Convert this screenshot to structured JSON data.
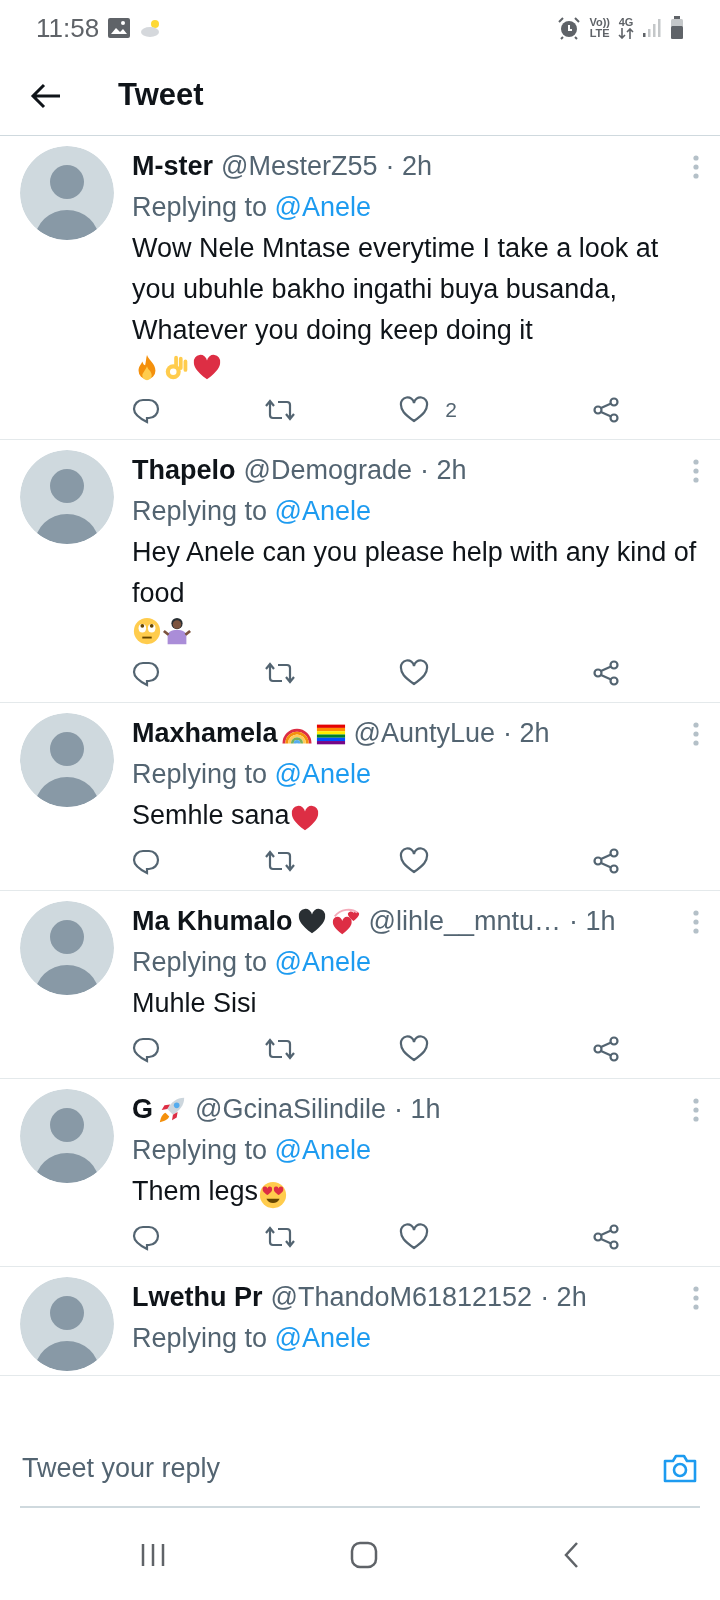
{
  "status_bar": {
    "time": "11:58",
    "volte": "Vo))",
    "lte": "LTE",
    "network": "4G"
  },
  "header": {
    "title": "Tweet"
  },
  "tweets": [
    {
      "name": "M-ster",
      "handle": "@MesterZ55",
      "time": "· 2h",
      "replying_label": "Replying to",
      "replying_handle": "@Anele",
      "text": "Wow Nele Mntase everytime I take a look at you ubuhle bakho ingathi buya busanda, Whatever you doing keep doing it",
      "text_emojis": [
        {
          "kind": "fire"
        },
        {
          "kind": "ok-hand"
        },
        {
          "kind": "heart"
        }
      ],
      "like_count": "2",
      "liked": false
    },
    {
      "name": "Thapelo",
      "handle": "@Demograde",
      "time": "· 2h",
      "replying_label": "Replying to",
      "replying_handle": "@Anele",
      "text": "Hey Anele can you please help with any kind of food",
      "text_emojis": [
        {
          "kind": "rolling-eyes"
        },
        {
          "kind": "shrug"
        }
      ],
      "liked": false
    },
    {
      "name": "Maxhamela",
      "name_emojis": [
        {
          "kind": "rainbow"
        },
        {
          "kind": "pride-flag"
        }
      ],
      "handle": "@AuntyLue",
      "time": "· 2h",
      "replying_label": "Replying to",
      "replying_handle": "@Anele",
      "text": "Semhle sana",
      "text_emojis": [
        {
          "kind": "heart"
        }
      ],
      "liked": false
    },
    {
      "name": "Ma Khumalo",
      "name_emojis": [
        {
          "kind": "dark-heart"
        },
        {
          "kind": "two-hearts"
        }
      ],
      "handle": "@lihle__mntu…",
      "time": "· 1h",
      "replying_label": "Replying to",
      "replying_handle": "@Anele",
      "text": "Muhle Sisi",
      "liked": false
    },
    {
      "name": "G",
      "name_emojis": [
        {
          "kind": "rocket"
        }
      ],
      "handle": "@GcinaSilindile",
      "time": "· 1h",
      "replying_label": "Replying to",
      "replying_handle": "@Anele",
      "text": "Them legs",
      "text_emojis": [
        {
          "kind": "heart-eyes"
        }
      ],
      "liked": false
    },
    {
      "name": "Lwethu Pr",
      "handle": "@ThandoM61812152",
      "time": "· 2h",
      "replying_label": "Replying to",
      "replying_handle": "@Anele"
    }
  ],
  "reply_bar": {
    "placeholder": "Tweet your reply"
  }
}
